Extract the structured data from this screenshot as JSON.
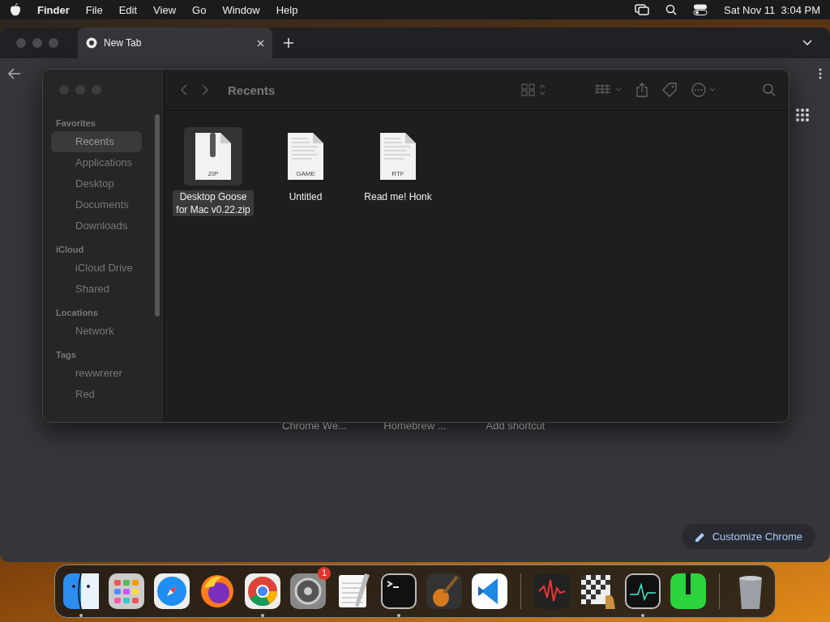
{
  "menu_bar": {
    "app": "Finder",
    "items": [
      "File",
      "Edit",
      "View",
      "Go",
      "Window",
      "Help"
    ],
    "clock": "Sat Nov 11  3:04 PM"
  },
  "browser": {
    "tab": {
      "title": "New Tab",
      "selected": true
    },
    "shortcuts": [
      "Chrome We...",
      "Homebrew ...",
      "Add shortcut"
    ],
    "customize_button": "Customize Chrome"
  },
  "finder": {
    "title": "Recents",
    "sidebar": [
      {
        "heading": "Favorites",
        "items": [
          {
            "label": "Recents",
            "selected": true
          },
          {
            "label": "Applications",
            "selected": false
          },
          {
            "label": "Desktop",
            "selected": false
          },
          {
            "label": "Documents",
            "selected": false
          },
          {
            "label": "Downloads",
            "selected": false
          }
        ]
      },
      {
        "heading": "iCloud",
        "items": [
          {
            "label": "iCloud Drive",
            "selected": false
          },
          {
            "label": "Shared",
            "selected": false
          }
        ]
      },
      {
        "heading": "Locations",
        "items": [
          {
            "label": "Network",
            "selected": false
          }
        ]
      },
      {
        "heading": "Tags",
        "items": [
          {
            "label": "rewwrerer",
            "selected": false
          },
          {
            "label": "Red",
            "selected": false
          }
        ]
      }
    ],
    "files": [
      {
        "name": "Desktop Goose for Mac v0.22.zip",
        "type": "ZIP",
        "kind": "zip",
        "selected": true
      },
      {
        "name": "Untitled",
        "type": "GAME",
        "kind": "doc",
        "selected": false
      },
      {
        "name": "Read me! Honk",
        "type": "RTF",
        "kind": "doc",
        "selected": false
      }
    ]
  },
  "dock": [
    {
      "kind": "finder",
      "running": true
    },
    {
      "kind": "launchpad",
      "running": false
    },
    {
      "kind": "safari",
      "running": false
    },
    {
      "kind": "firefox",
      "running": false
    },
    {
      "kind": "chrome",
      "running": true
    },
    {
      "kind": "settings",
      "running": false,
      "badge": "1"
    },
    {
      "kind": "textedit",
      "running": false
    },
    {
      "kind": "terminal",
      "running": true
    },
    {
      "kind": "guitar",
      "running": false
    },
    {
      "kind": "vscode",
      "running": false
    },
    {
      "kind": "divider"
    },
    {
      "kind": "audio",
      "running": false
    },
    {
      "kind": "chess",
      "running": false
    },
    {
      "kind": "monitor",
      "running": true
    },
    {
      "kind": "archive",
      "running": false
    },
    {
      "kind": "divider"
    },
    {
      "kind": "trash",
      "running": false
    }
  ]
}
